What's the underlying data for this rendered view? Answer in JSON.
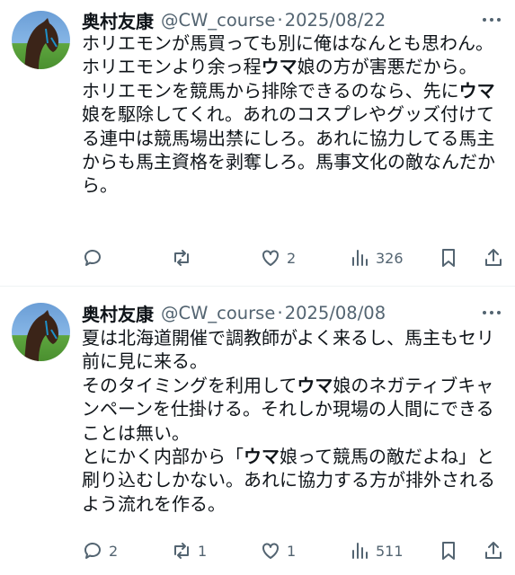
{
  "tweets": [
    {
      "author_name": "奥村友康",
      "handle": "@CW_course",
      "separator": "·",
      "date": "2025/08/22",
      "text": [
        {
          "t": "ホリエモンが馬買っても別に俺はなんとも思わん。ホリエモンより余っ程",
          "b": false
        },
        {
          "t": "ウマ",
          "b": true
        },
        {
          "t": "娘の方が害悪だから。\nホリエモンを競馬から排除できるのなら、先に",
          "b": false
        },
        {
          "t": "ウマ",
          "b": true
        },
        {
          "t": "娘を駆除してくれ。あれのコスプレやグッズ付けてる連中は競馬場出禁にしろ。あれに協力してる馬主からも馬主資格を剥奪しろ。馬事文化の敵なんだから。",
          "b": false
        }
      ],
      "replies": "",
      "retweets": "",
      "likes": "2",
      "views": "326"
    },
    {
      "author_name": "奥村友康",
      "handle": "@CW_course",
      "separator": "·",
      "date": "2025/08/08",
      "text": [
        {
          "t": "夏は北海道開催で調教師がよく来るし、馬主もセリ前に見に来る。\nそのタイミングを利用して",
          "b": false
        },
        {
          "t": "ウマ",
          "b": true
        },
        {
          "t": "娘のネガティブキャンペーンを仕掛ける。それしか現場の人間にできることは無い。\nとにかく内部から「",
          "b": false
        },
        {
          "t": "ウマ",
          "b": true
        },
        {
          "t": "娘って競馬の敵だよね」と刷り込むしかない。あれに協力する方が排外されるよう流れを作る。",
          "b": false
        }
      ],
      "replies": "2",
      "retweets": "1",
      "likes": "1",
      "views": "511"
    }
  ],
  "icons": [
    "reply-icon",
    "retweet-icon",
    "like-icon",
    "views-icon",
    "bookmark-icon",
    "share-icon",
    "more-icon"
  ],
  "colors": {
    "text": "#0f1419",
    "secondary": "#536471",
    "divider": "#eff3f4"
  }
}
